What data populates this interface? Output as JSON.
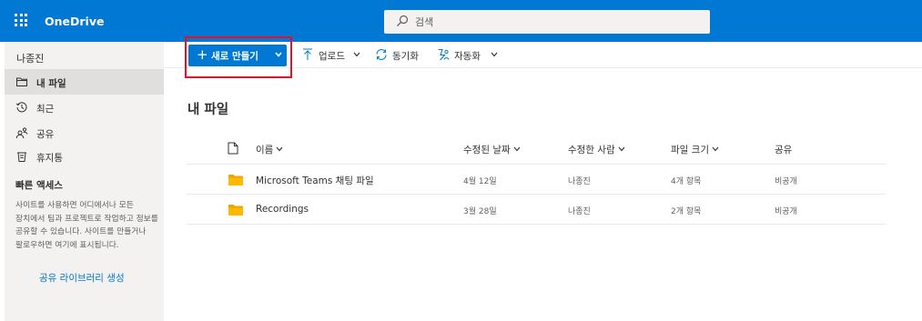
{
  "app": {
    "name": "OneDrive"
  },
  "search": {
    "placeholder": "검색"
  },
  "sidebar": {
    "user": "나종진",
    "items": [
      {
        "label": "내 파일",
        "icon": "folder-icon",
        "active": true
      },
      {
        "label": "최근",
        "icon": "history-icon",
        "active": false
      },
      {
        "label": "공유",
        "icon": "people-icon",
        "active": false
      },
      {
        "label": "휴지통",
        "icon": "recycle-bin-icon",
        "active": false
      }
    ],
    "quick_access": {
      "title": "빠른 액세스",
      "description": "사이트를 사용하면 어디에서나 모든 장치에서 팀과 프로젝트로 작업하고 정보를 공유할 수 있습니다. 사이트를 만들거나 팔로우하면 여기에 표시됩니다.",
      "link": "공유 라이브러리 생성"
    }
  },
  "commandbar": {
    "new_label": "새로 만들기",
    "upload_label": "업로드",
    "sync_label": "동기화",
    "automate_label": "자동화"
  },
  "main": {
    "title": "내 파일",
    "columns": {
      "name": "이름",
      "modified": "수정된 날짜",
      "modified_by": "수정한 사람",
      "size": "파일 크기",
      "sharing": "공유"
    },
    "rows": [
      {
        "name": "Microsoft Teams 채팅 파일",
        "modified": "4월 12일",
        "modified_by": "나종진",
        "size": "4개 항목",
        "sharing": "비공개"
      },
      {
        "name": "Recordings",
        "modified": "3월 28일",
        "modified_by": "나종진",
        "size": "2개 항목",
        "sharing": "비공개"
      }
    ]
  },
  "colors": {
    "brand_blue": "#0078d4",
    "folder_yellow": "#ffb900",
    "highlight_red": "#e81123",
    "sidebar_bg": "#f3f2f1"
  }
}
